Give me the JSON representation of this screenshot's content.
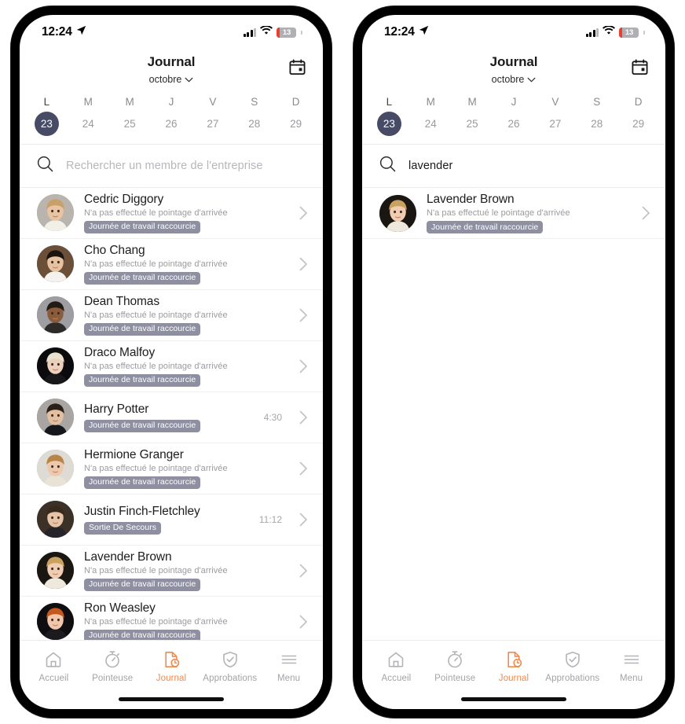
{
  "colors": {
    "accent_orange": "#f08b4c",
    "selected_day": "#474b66",
    "badge_bg": "#8e90a2",
    "battery_low": "#f03c2e"
  },
  "status_bar": {
    "time": "12:24",
    "location_icon": "location-arrow-icon",
    "signal_icon": "cellular-signal-icon",
    "wifi_icon": "wifi-icon",
    "battery_percent": "13"
  },
  "header": {
    "title": "Journal",
    "month": "octobre",
    "month_chevron": "chevron-down-icon",
    "calendar_icon": "calendar-icon"
  },
  "week": {
    "days": [
      {
        "dow": "L",
        "num": "23",
        "selected": true
      },
      {
        "dow": "M",
        "num": "24",
        "selected": false
      },
      {
        "dow": "M",
        "num": "25",
        "selected": false
      },
      {
        "dow": "J",
        "num": "26",
        "selected": false
      },
      {
        "dow": "V",
        "num": "27",
        "selected": false
      },
      {
        "dow": "S",
        "num": "28",
        "selected": false
      },
      {
        "dow": "D",
        "num": "29",
        "selected": false
      }
    ]
  },
  "phone_left": {
    "search": {
      "icon": "search-icon",
      "placeholder": "Rechercher un membre de l'entreprise",
      "value": ""
    },
    "list": [
      {
        "name": "Cedric Diggory",
        "subtitle": "N'a pas effectué le pointage d'arrivée",
        "badge": "Journée de travail raccourcie",
        "time": "",
        "avatar_hair": "#c9a06a",
        "avatar_skin": "#e8c3a4",
        "avatar_bg": "#b9b4ad",
        "avatar_cloth": "#f2efe6"
      },
      {
        "name": "Cho Chang",
        "subtitle": "N'a pas effectué le pointage d'arrivée",
        "badge": "Journée de travail raccourcie",
        "time": "",
        "avatar_hair": "#181410",
        "avatar_skin": "#e6c2a0",
        "avatar_bg": "#6b4f38",
        "avatar_cloth": "#f4f2ee"
      },
      {
        "name": "Dean Thomas",
        "subtitle": "N'a pas effectué le pointage d'arrivée",
        "badge": "Journée de travail raccourcie",
        "time": "",
        "avatar_hair": "#231a14",
        "avatar_skin": "#8a5c3b",
        "avatar_bg": "#9d9da2",
        "avatar_cloth": "#2d2b2a"
      },
      {
        "name": "Draco Malfoy",
        "subtitle": "N'a pas effectué le pointage d'arrivée",
        "badge": "Journée de travail raccourcie",
        "time": "",
        "avatar_hair": "#e8e3cf",
        "avatar_skin": "#ecd0bb",
        "avatar_bg": "#0b0b0d",
        "avatar_cloth": "#17171a"
      },
      {
        "name": "Harry Potter",
        "subtitle": "",
        "badge": "Journée de travail raccourcie",
        "time": "4:30",
        "avatar_hair": "#2b2018",
        "avatar_skin": "#e3bfa2",
        "avatar_bg": "#a8a5a3",
        "avatar_cloth": "#15171c"
      },
      {
        "name": "Hermione Granger",
        "subtitle": "N'a pas effectué le pointage d'arrivée",
        "badge": "Journée de travail raccourcie",
        "time": "",
        "avatar_hair": "#b8844a",
        "avatar_skin": "#ecc9ad",
        "avatar_bg": "#dedbd4",
        "avatar_cloth": "#e9e3d6"
      },
      {
        "name": "Justin Finch-Fletchley",
        "subtitle": "",
        "badge": "Sortie De Secours",
        "time": "11:12",
        "avatar_hair": "#3a2a1e",
        "avatar_skin": "#e7c4a6",
        "avatar_bg": "#3b3127",
        "avatar_cloth": "#24242a"
      },
      {
        "name": "Lavender Brown",
        "subtitle": "N'a pas effectué le pointage d'arrivée",
        "badge": "Journée de travail raccourcie",
        "time": "",
        "avatar_hair": "#caa25f",
        "avatar_skin": "#f0cdb2",
        "avatar_bg": "#1a1612",
        "avatar_cloth": "#efe9dd"
      },
      {
        "name": "Ron Weasley",
        "subtitle": "N'a pas effectué le pointage d'arrivée",
        "badge": "Journée de travail raccourcie",
        "time": "",
        "avatar_hair": "#c4581f",
        "avatar_skin": "#f0c7ab",
        "avatar_bg": "#0e0e10",
        "avatar_cloth": "#1b1b1f"
      }
    ]
  },
  "phone_right": {
    "search": {
      "icon": "search-icon",
      "placeholder": "Rechercher un membre de l'entreprise",
      "value": "lavender"
    },
    "list": [
      {
        "name": "Lavender Brown",
        "subtitle": "N'a pas effectué le pointage d'arrivée",
        "badge": "Journée de travail raccourcie",
        "time": "",
        "avatar_hair": "#caa25f",
        "avatar_skin": "#f0cdb2",
        "avatar_bg": "#1a1612",
        "avatar_cloth": "#efe9dd"
      }
    ]
  },
  "tabbar": {
    "items": [
      {
        "label": "Accueil",
        "icon": "home-icon",
        "active": false
      },
      {
        "label": "Pointeuse",
        "icon": "stopwatch-icon",
        "active": false
      },
      {
        "label": "Journal",
        "icon": "journal-clock-icon",
        "active": true
      },
      {
        "label": "Approbations",
        "icon": "shield-check-icon",
        "active": false
      },
      {
        "label": "Menu",
        "icon": "hamburger-icon",
        "active": false
      }
    ]
  }
}
